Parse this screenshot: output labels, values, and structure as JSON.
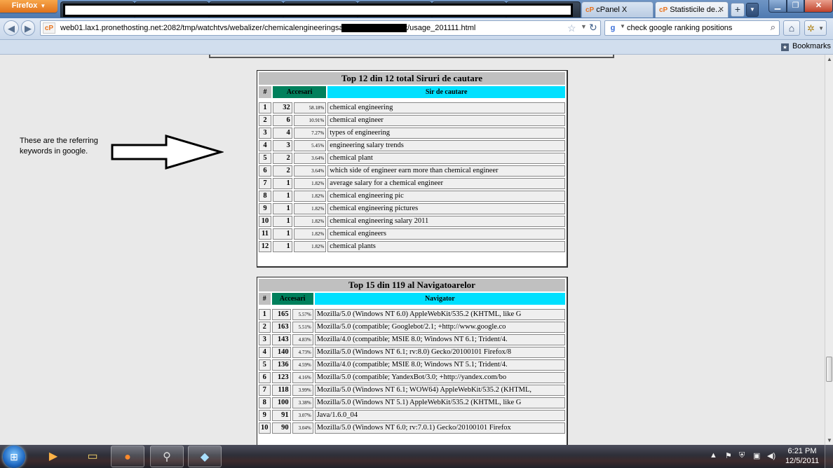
{
  "browser": {
    "firefox_button": "Firefox",
    "tabs": [
      {
        "label": "cPanel X"
      },
      {
        "label": "Statisticile de..."
      }
    ],
    "url_start": "web01.lax1.pronethosting.net:2082/tmp/watchtvs/webalizer/chemicalengineeringsalary",
    "url_end": "t/usage_201111.html",
    "search_text": "check google ranking positions",
    "bookmarks_label": "Bookmarks"
  },
  "annotation": "These are the referring keywords in google.",
  "search_table": {
    "title": "Top 12 din 12 total Siruri de cautare",
    "col_num": "#",
    "col_hits": "Accesari",
    "col_item": "Sir de cautare",
    "rows": [
      {
        "n": "1",
        "hits": "32",
        "pct": "58.18%",
        "text": "chemical engineering"
      },
      {
        "n": "2",
        "hits": "6",
        "pct": "10.91%",
        "text": "chemical engineer"
      },
      {
        "n": "3",
        "hits": "4",
        "pct": "7.27%",
        "text": "types of engineering"
      },
      {
        "n": "4",
        "hits": "3",
        "pct": "5.45%",
        "text": "engineering salary trends"
      },
      {
        "n": "5",
        "hits": "2",
        "pct": "3.64%",
        "text": "chemical plant"
      },
      {
        "n": "6",
        "hits": "2",
        "pct": "3.64%",
        "text": "which side of engineer earn more than chemical engineer"
      },
      {
        "n": "7",
        "hits": "1",
        "pct": "1.82%",
        "text": "average salary for a chemical engineer"
      },
      {
        "n": "8",
        "hits": "1",
        "pct": "1.82%",
        "text": "chemical engineering pic"
      },
      {
        "n": "9",
        "hits": "1",
        "pct": "1.82%",
        "text": "chemical engineering pictures"
      },
      {
        "n": "10",
        "hits": "1",
        "pct": "1.82%",
        "text": "chemical engineering salary 2011"
      },
      {
        "n": "11",
        "hits": "1",
        "pct": "1.82%",
        "text": "chemical engineers"
      },
      {
        "n": "12",
        "hits": "1",
        "pct": "1.82%",
        "text": "chemical plants"
      }
    ]
  },
  "browser_table": {
    "title": "Top 15 din 119 al Navigatoarelor",
    "col_num": "#",
    "col_hits": "Accesari",
    "col_item": "Navigator",
    "rows": [
      {
        "n": "1",
        "hits": "165",
        "pct": "5.57%",
        "text": "Mozilla/5.0 (Windows NT 6.0) AppleWebKit/535.2 (KHTML, like G"
      },
      {
        "n": "2",
        "hits": "163",
        "pct": "5.51%",
        "text": "Mozilla/5.0 (compatible; Googlebot/2.1; +http://www.google.co"
      },
      {
        "n": "3",
        "hits": "143",
        "pct": "4.83%",
        "text": "Mozilla/4.0 (compatible; MSIE 8.0; Windows NT 6.1; Trident/4."
      },
      {
        "n": "4",
        "hits": "140",
        "pct": "4.73%",
        "text": "Mozilla/5.0 (Windows NT 6.1; rv:8.0) Gecko/20100101 Firefox/8"
      },
      {
        "n": "5",
        "hits": "136",
        "pct": "4.59%",
        "text": "Mozilla/4.0 (compatible; MSIE 8.0; Windows NT 5.1; Trident/4."
      },
      {
        "n": "6",
        "hits": "123",
        "pct": "4.16%",
        "text": "Mozilla/5.0 (compatible; YandexBot/3.0; +http://yandex.com/bo"
      },
      {
        "n": "7",
        "hits": "118",
        "pct": "3.99%",
        "text": "Mozilla/5.0 (Windows NT 6.1; WOW64) AppleWebKit/535.2 (KHTML,"
      },
      {
        "n": "8",
        "hits": "100",
        "pct": "3.38%",
        "text": "Mozilla/5.0 (Windows NT 5.1) AppleWebKit/535.2 (KHTML, like G"
      },
      {
        "n": "9",
        "hits": "91",
        "pct": "3.07%",
        "text": "Java/1.6.0_04"
      },
      {
        "n": "10",
        "hits": "90",
        "pct": "3.04%",
        "text": "Mozilla/5.0 (Windows NT 6.0; rv:7.0.1) Gecko/20100101 Firefox"
      }
    ]
  },
  "taskbar": {
    "time": "6:21 PM",
    "date": "12/5/2011"
  },
  "colors": {
    "hits_header": "#00805c",
    "item_header": "#00e0ff",
    "title_bg": "#c0c0c0"
  }
}
